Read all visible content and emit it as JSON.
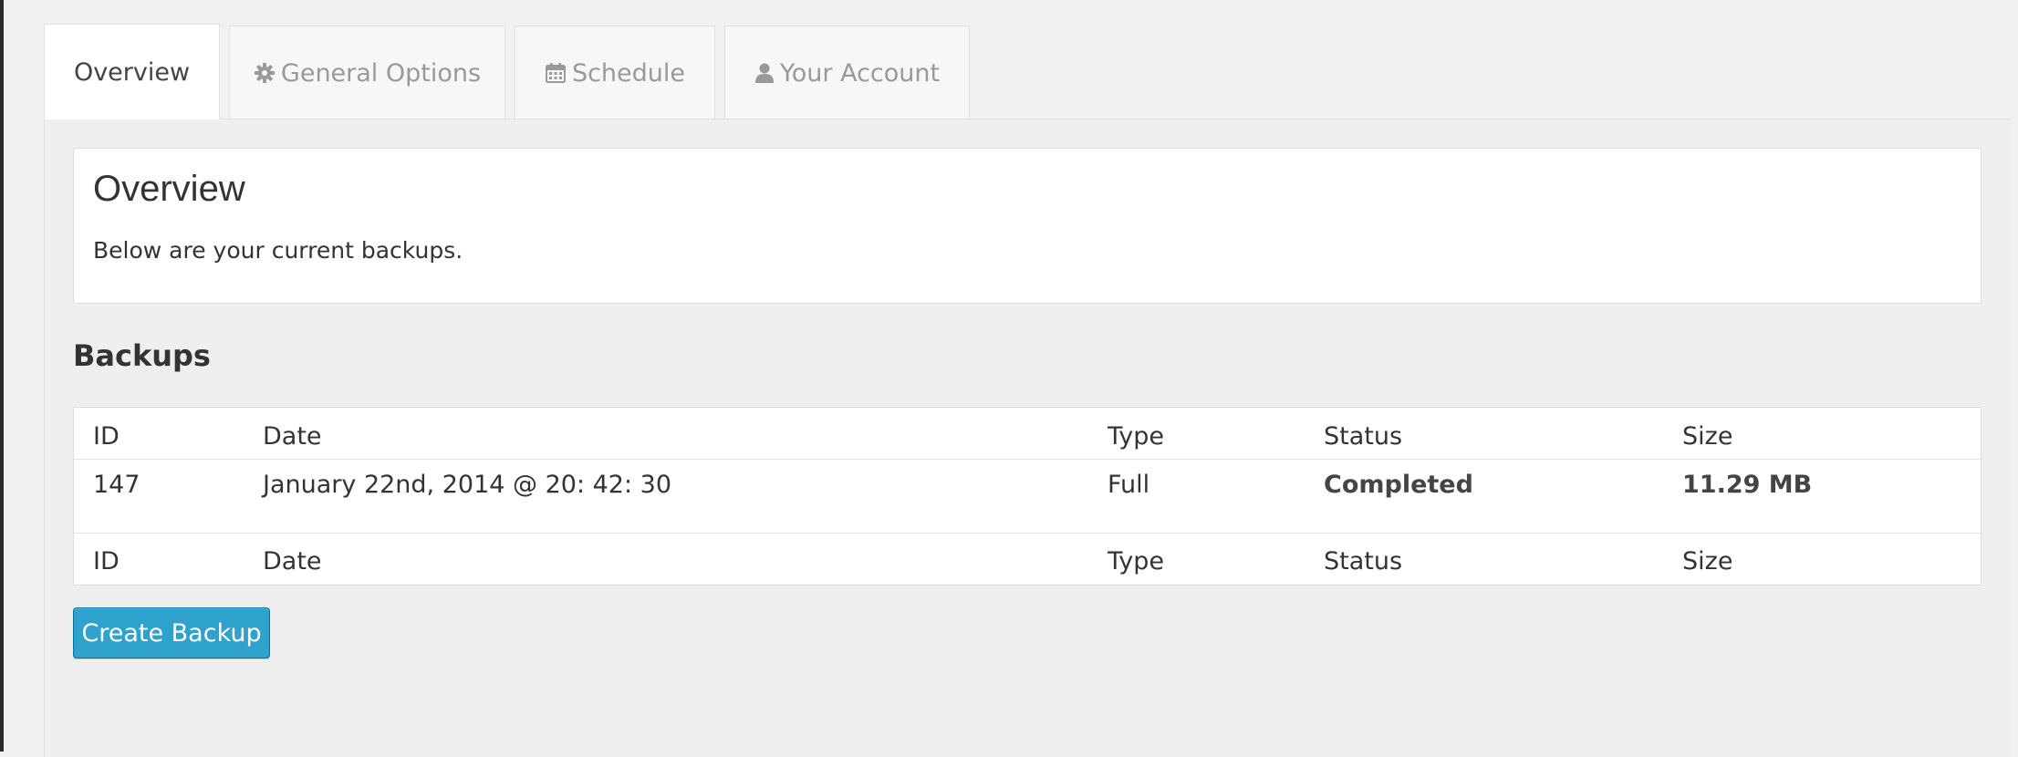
{
  "tabs": [
    {
      "label": "Overview",
      "icon": "",
      "active": true
    },
    {
      "label": "General Options",
      "icon": "gear-icon",
      "active": false
    },
    {
      "label": "Schedule",
      "icon": "calendar-icon",
      "active": false
    },
    {
      "label": "Your Account",
      "icon": "user-icon",
      "active": false
    }
  ],
  "overview": {
    "title": "Overview",
    "subtitle": "Below are your current backups."
  },
  "backups": {
    "title": "Backups",
    "columns": [
      "ID",
      "Date",
      "Type",
      "Status",
      "Size"
    ],
    "rows": [
      {
        "id": "147",
        "date": "January 22nd, 2014 @ 20: 42: 30",
        "type": "Full",
        "status": "Completed",
        "size": "11.29 MB"
      }
    ]
  },
  "actions": {
    "create_backup_label": "Create Backup"
  },
  "colors": {
    "button_bg": "#2ea2cc",
    "button_border": "#0074a2",
    "page_bg": "#f1f1f1"
  }
}
